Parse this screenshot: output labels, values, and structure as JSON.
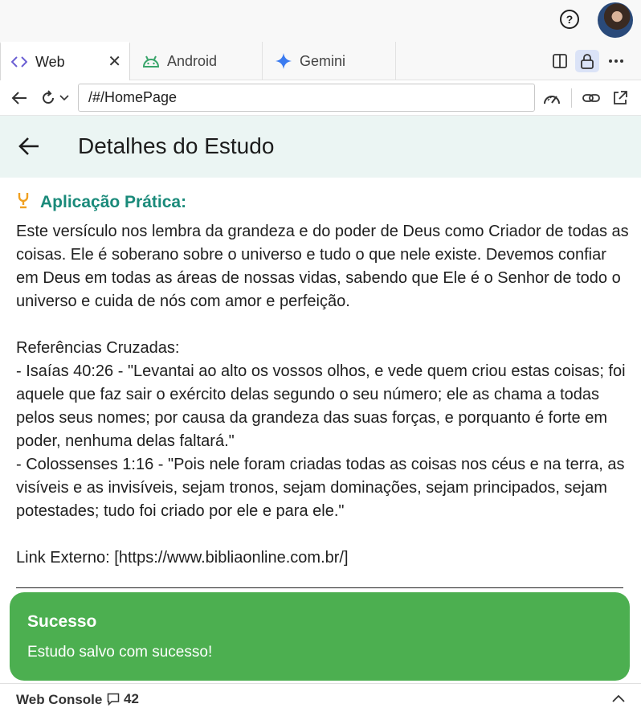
{
  "tabs": [
    {
      "label": "Web",
      "icon": "code-icon"
    },
    {
      "label": "Android",
      "icon": "android-icon"
    },
    {
      "label": "Gemini",
      "icon": "gemini-sparkle-icon"
    }
  ],
  "address": {
    "url": "/#/HomePage"
  },
  "app": {
    "title": "Detalhes do Estudo",
    "section_title": "Aplicação Prática:",
    "body": "Este versículo nos lembra da grandeza e do poder de Deus como Criador de todas as coisas. Ele é soberano sobre o universo e tudo o que nele existe. Devemos confiar em Deus em todas as áreas de nossas vidas, sabendo que Ele é o Senhor de todo o universo e cuida de nós com amor e perfeição.\n\nReferências Cruzadas:\n- Isaías 40:26 - \"Levantai ao alto os vossos olhos, e vede quem criou estas coisas; foi aquele que faz sair o exército delas segundo o seu número; ele as chama a todas pelos seus nomes; por causa da grandeza das suas forças, e porquanto é forte em poder, nenhuma delas faltará.\"\n- Colossenses 1:16 - \"Pois nele foram criadas todas as coisas nos céus e na terra, as visíveis e as invisíveis, sejam tronos, sejam dominações, sejam principados, sejam potestades; tudo foi criado por ele e para ele.\"\n\nLink Externo: [https://www.bibliaonline.com.br/]"
  },
  "snackbar": {
    "title": "Sucesso",
    "message": "Estudo salvo com sucesso!",
    "color": "#4caf50"
  },
  "console": {
    "label": "Web Console",
    "count": "42"
  },
  "colors": {
    "accent": "#1a8a7a",
    "header_bg": "#ebf5f3",
    "lightbulb": "#f0a020"
  }
}
